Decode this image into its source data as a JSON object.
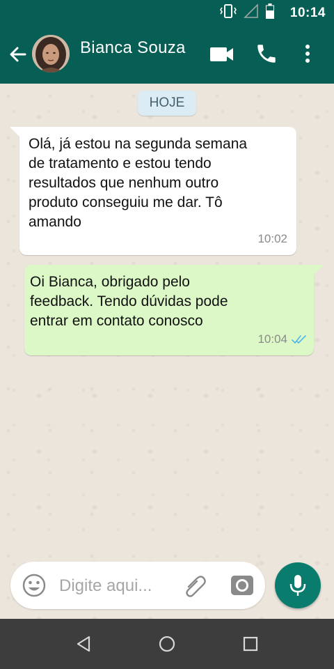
{
  "status_bar": {
    "time": "10:14",
    "icons": [
      "vibrate-icon",
      "signal-icon",
      "battery-icon"
    ]
  },
  "header": {
    "contact_name": "Bianca Souza",
    "icons": [
      "back-arrow-icon",
      "video-call-icon",
      "phone-icon",
      "more-vert-icon"
    ]
  },
  "chat": {
    "date_label": "HOJE",
    "messages": [
      {
        "direction": "incoming",
        "text": "Olá, já estou na segunda semana de tratamento e estou tendo resultados que nenhum outro produto conseguiu me dar. Tô amando",
        "time": "10:02"
      },
      {
        "direction": "outgoing",
        "text": "Oi Bianca, obrigado pelo\n feedback. Tendo dúvidas pode entrar em contato conosco",
        "time": "10:04",
        "status": "read"
      }
    ]
  },
  "input_bar": {
    "placeholder": "Digite aqui...",
    "icons": [
      "emoji-icon",
      "attach-icon",
      "camera-icon",
      "mic-icon"
    ]
  },
  "nav_bar": {
    "icons": [
      "nav-back-icon",
      "nav-home-icon",
      "nav-recents-icon"
    ]
  },
  "colors": {
    "header": "#075e54",
    "incoming_bubble": "#ffffff",
    "outgoing_bubble": "#dcf8c6",
    "date_pill": "#dcecf4",
    "mic_button": "#0a7c6e",
    "read_ticks": "#4fb6ec"
  }
}
